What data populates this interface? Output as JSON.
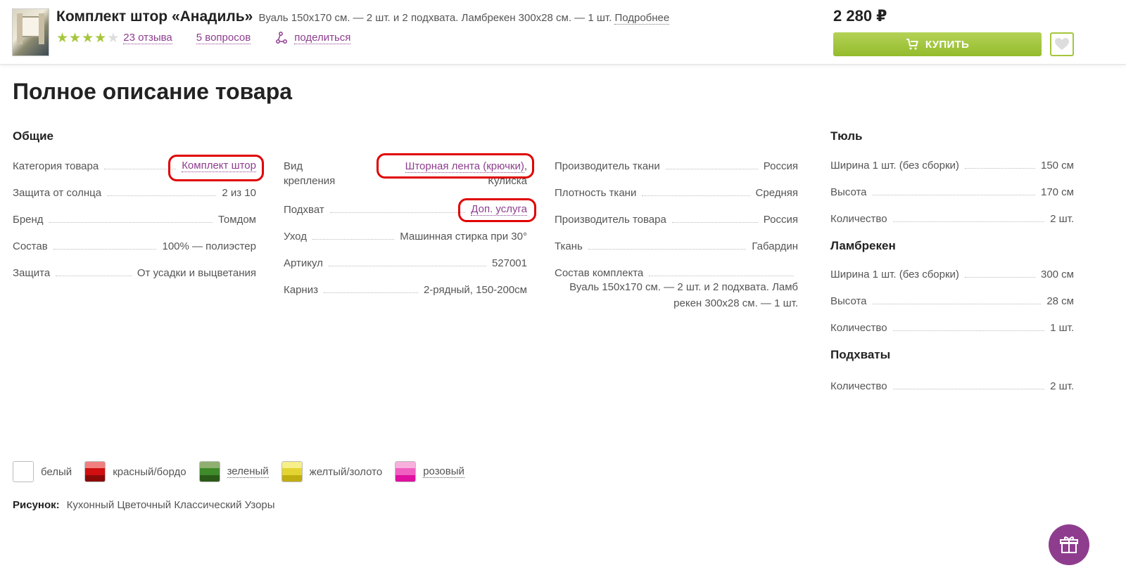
{
  "product": {
    "name": "Комплект штор «Анадиль»",
    "subtitle": "Вуаль 150х170 см. — 2 шт. и 2 подхвата. Ламбрекен 300х28 см. — 1 шт.",
    "more_link": "Подробнее",
    "rating": 4,
    "rating_max": 5,
    "reviews_link": "23 отзыва",
    "questions_link": "5 вопросов",
    "share_link": "поделиться",
    "price": "2 280 ₽",
    "buy_label": "КУПИТЬ"
  },
  "section_title": "Полное описание товара",
  "columns": {
    "general": {
      "title": "Общие",
      "rows": [
        {
          "key": "Категория товара",
          "value": "Комплект штор"
        },
        {
          "key": "Защита от солнца",
          "value": "2 из 10"
        },
        {
          "key": "Бренд",
          "value": "Томдом"
        },
        {
          "key": "Состав",
          "value": "100% — полиэстер"
        },
        {
          "key": "Защита",
          "value": "От усадки и выцветания"
        }
      ]
    },
    "col2": {
      "rows": [
        {
          "key": "Вид",
          "key2": "крепления",
          "value": "Шторная лента (крючки)",
          "value_suffix": ",",
          "value2": "Кулиска"
        },
        {
          "key": "Подхват",
          "value": "Доп. услуга"
        },
        {
          "key": "Уход",
          "value": "Машинная стирка при 30°"
        },
        {
          "key": "Артикул",
          "value": "527001"
        },
        {
          "key": "Карниз",
          "value": "2-рядный, 150-200см"
        }
      ]
    },
    "col3": {
      "rows": [
        {
          "key": "Производитель ткани",
          "value": "Россия"
        },
        {
          "key": "Плотность ткани",
          "value": "Средняя"
        },
        {
          "key": "Производитель товара",
          "value": "Россия"
        },
        {
          "key": "Ткань",
          "value": "Габардин"
        },
        {
          "key": "Состав комплекта",
          "value_line1": "Вуаль 150х170 см. — 2 шт. и 2 подхвата. Ламб",
          "value_line2": "рекен 300х28 см. — 1 шт."
        }
      ]
    },
    "col4": {
      "groups": [
        {
          "title": "Тюль",
          "rows": [
            {
              "key": "Ширина 1 шт. (без сборки)",
              "value": "150 см"
            },
            {
              "key": "Высота",
              "value": "170 см"
            },
            {
              "key": "Количество",
              "value": "2 шт."
            }
          ]
        },
        {
          "title": "Ламбрекен",
          "rows": [
            {
              "key": "Ширина 1 шт. (без сборки)",
              "value": "300 см"
            },
            {
              "key": "Высота",
              "value": "28 см"
            },
            {
              "key": "Количество",
              "value": "1 шт."
            }
          ]
        },
        {
          "title": "Подхваты",
          "rows": [
            {
              "key": "Количество",
              "value": "2 шт."
            }
          ]
        }
      ]
    }
  },
  "colors": [
    {
      "name": "белый",
      "swatch": [
        "#ffffff"
      ]
    },
    {
      "name": "красный/бордо",
      "swatch": [
        "#f08080",
        "#d01010",
        "#8a0a0a"
      ]
    },
    {
      "name": "зеленый",
      "swatch": [
        "#8fb070",
        "#3f8a2a",
        "#2a5a18"
      ]
    },
    {
      "name": "желтый/золото",
      "swatch": [
        "#f6ef8a",
        "#e4d433",
        "#c0ae10"
      ]
    },
    {
      "name": "розовый",
      "swatch": [
        "#f7b0dc",
        "#f060c0",
        "#e010a0"
      ]
    }
  ],
  "pattern": {
    "label": "Рисунок:",
    "value": "Кухонный Цветочный Классический Узоры"
  },
  "theme": {
    "accent": "#8e3d8e",
    "buy_green": "#a5c63b",
    "highlight": "#e00000"
  }
}
